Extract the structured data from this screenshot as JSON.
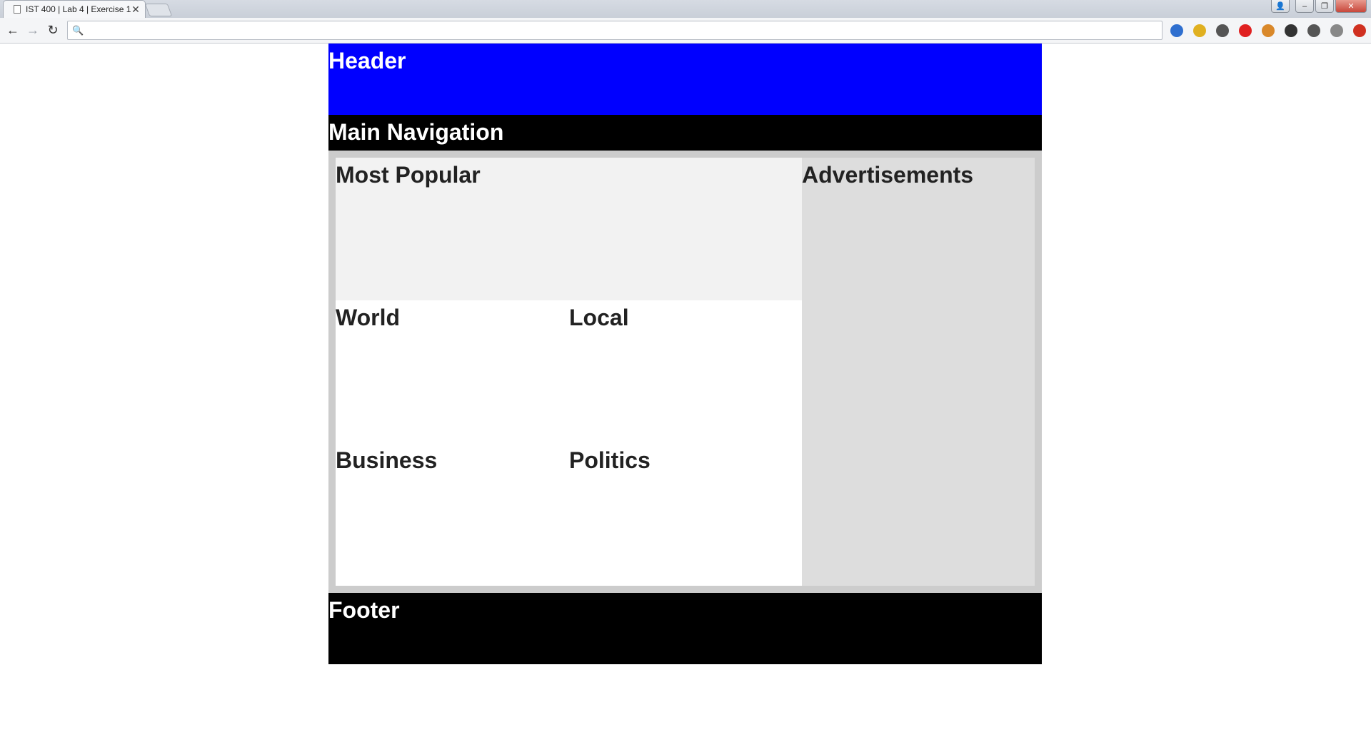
{
  "browser": {
    "tab_title": "IST 400 | Lab 4 | Exercise 1",
    "tab_close": "✕",
    "address_value": "",
    "back_glyph": "←",
    "forward_glyph": "→",
    "reload_glyph": "↻",
    "search_glyph": "🔍",
    "window": {
      "min": "–",
      "max": "❐",
      "close": "✕",
      "user": "👤"
    },
    "extensions": [
      {
        "icon": "globe-icon",
        "color": "#2f6fcf"
      },
      {
        "icon": "mail-icon",
        "color": "#e0b020"
      },
      {
        "icon": "eyedropper-icon",
        "color": "#555555"
      },
      {
        "icon": "play-icon",
        "color": "#e02020"
      },
      {
        "icon": "cookie-icon",
        "color": "#d9882a"
      },
      {
        "icon": "wordpress-icon",
        "color": "#333333"
      },
      {
        "icon": "check-icon",
        "color": "#555555"
      },
      {
        "icon": "clock-icon",
        "color": "#888888"
      },
      {
        "icon": "menu-icon",
        "color": "#d03020"
      }
    ]
  },
  "page": {
    "header": "Header",
    "main_navigation": "Main Navigation",
    "most_popular": "Most Popular",
    "world": "World",
    "local": "Local",
    "business": "Business",
    "politics": "Politics",
    "advertisements": "Advertisements",
    "footer": "Footer"
  },
  "colors": {
    "header_bg": "#0000ff",
    "nav_bg": "#000000",
    "content_bg": "#cccccc",
    "popular_bg": "#f2f2f2",
    "ads_bg": "#dddddd",
    "footer_bg": "#000000"
  }
}
